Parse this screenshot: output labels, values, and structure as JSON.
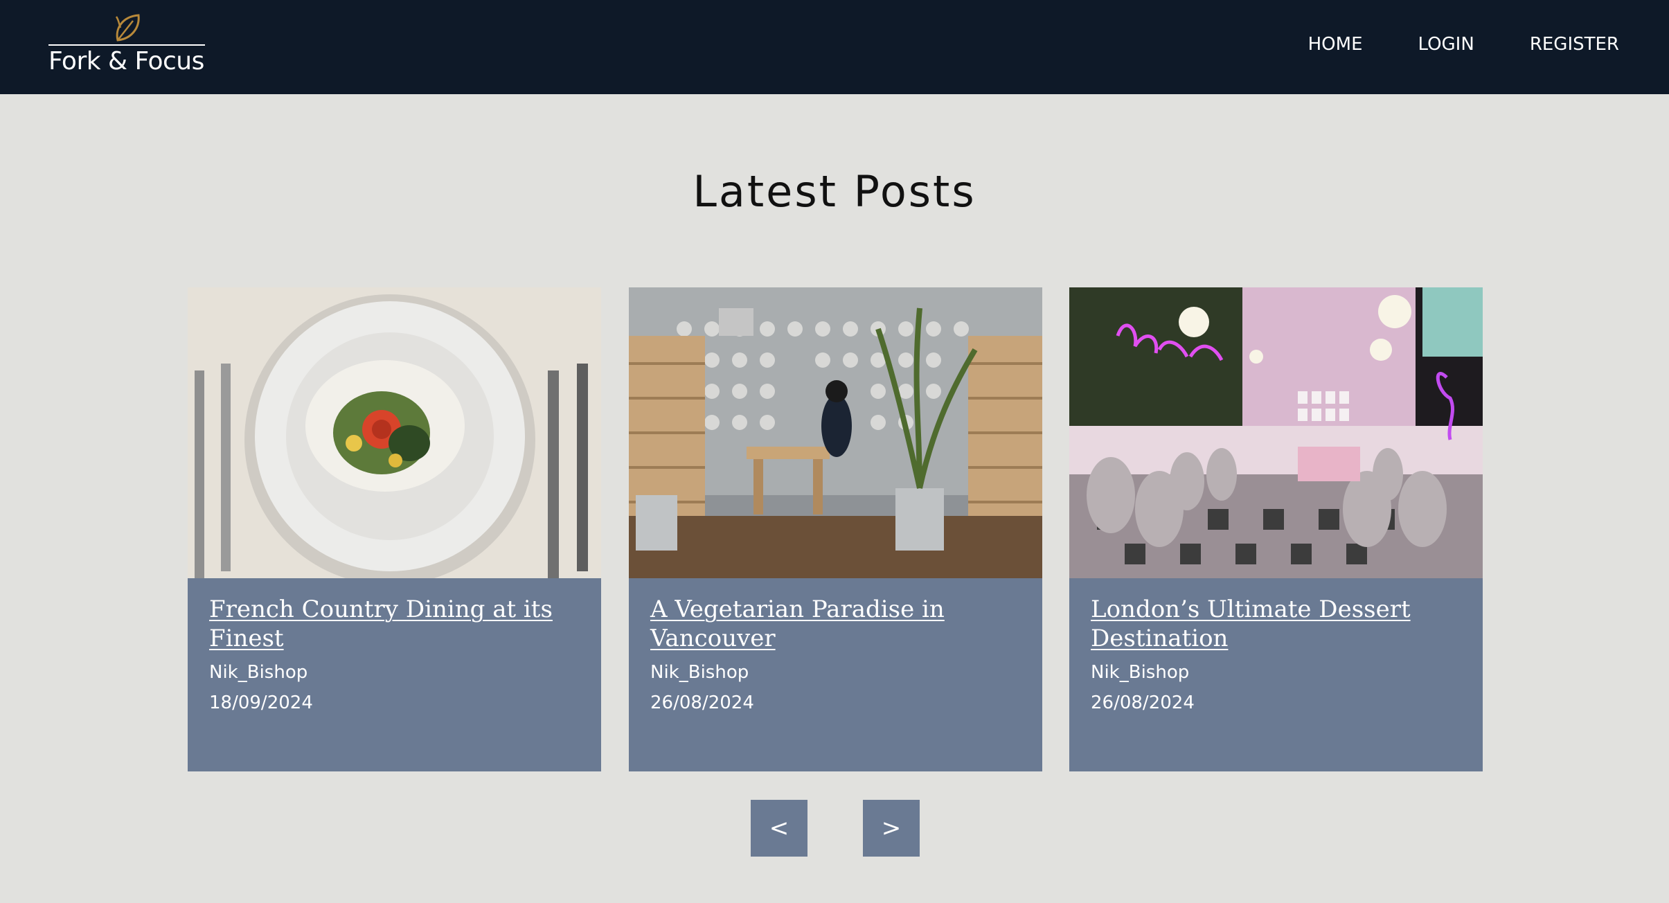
{
  "brand": {
    "name": "Fork & Focus",
    "icon": "leaf-icon",
    "icon_color": "#b8893a"
  },
  "nav": {
    "items": [
      {
        "label": "HOME"
      },
      {
        "label": "LOGIN"
      },
      {
        "label": "REGISTER"
      }
    ]
  },
  "main": {
    "title": "Latest Posts"
  },
  "posts": [
    {
      "title": "French Country Dining at its Finest",
      "author": "Nik_Bishop",
      "date": "18/09/2024",
      "image": "plated-dish-photo"
    },
    {
      "title": "A Vegetarian Paradise in Vancouver",
      "author": "Nik_Bishop",
      "date": "26/08/2024",
      "image": "restaurant-interior-photo"
    },
    {
      "title": "London’s Ultimate Dessert Destination",
      "author": "Nik_Bishop",
      "date": "26/08/2024",
      "image": "pink-cafe-interior-photo"
    }
  ],
  "pagination": {
    "prev_label": "<",
    "next_label": ">"
  },
  "colors": {
    "navbar": "#0e1928",
    "page_background": "#e1e1de",
    "card": "#6a7a93",
    "text_light": "#ffffff"
  }
}
